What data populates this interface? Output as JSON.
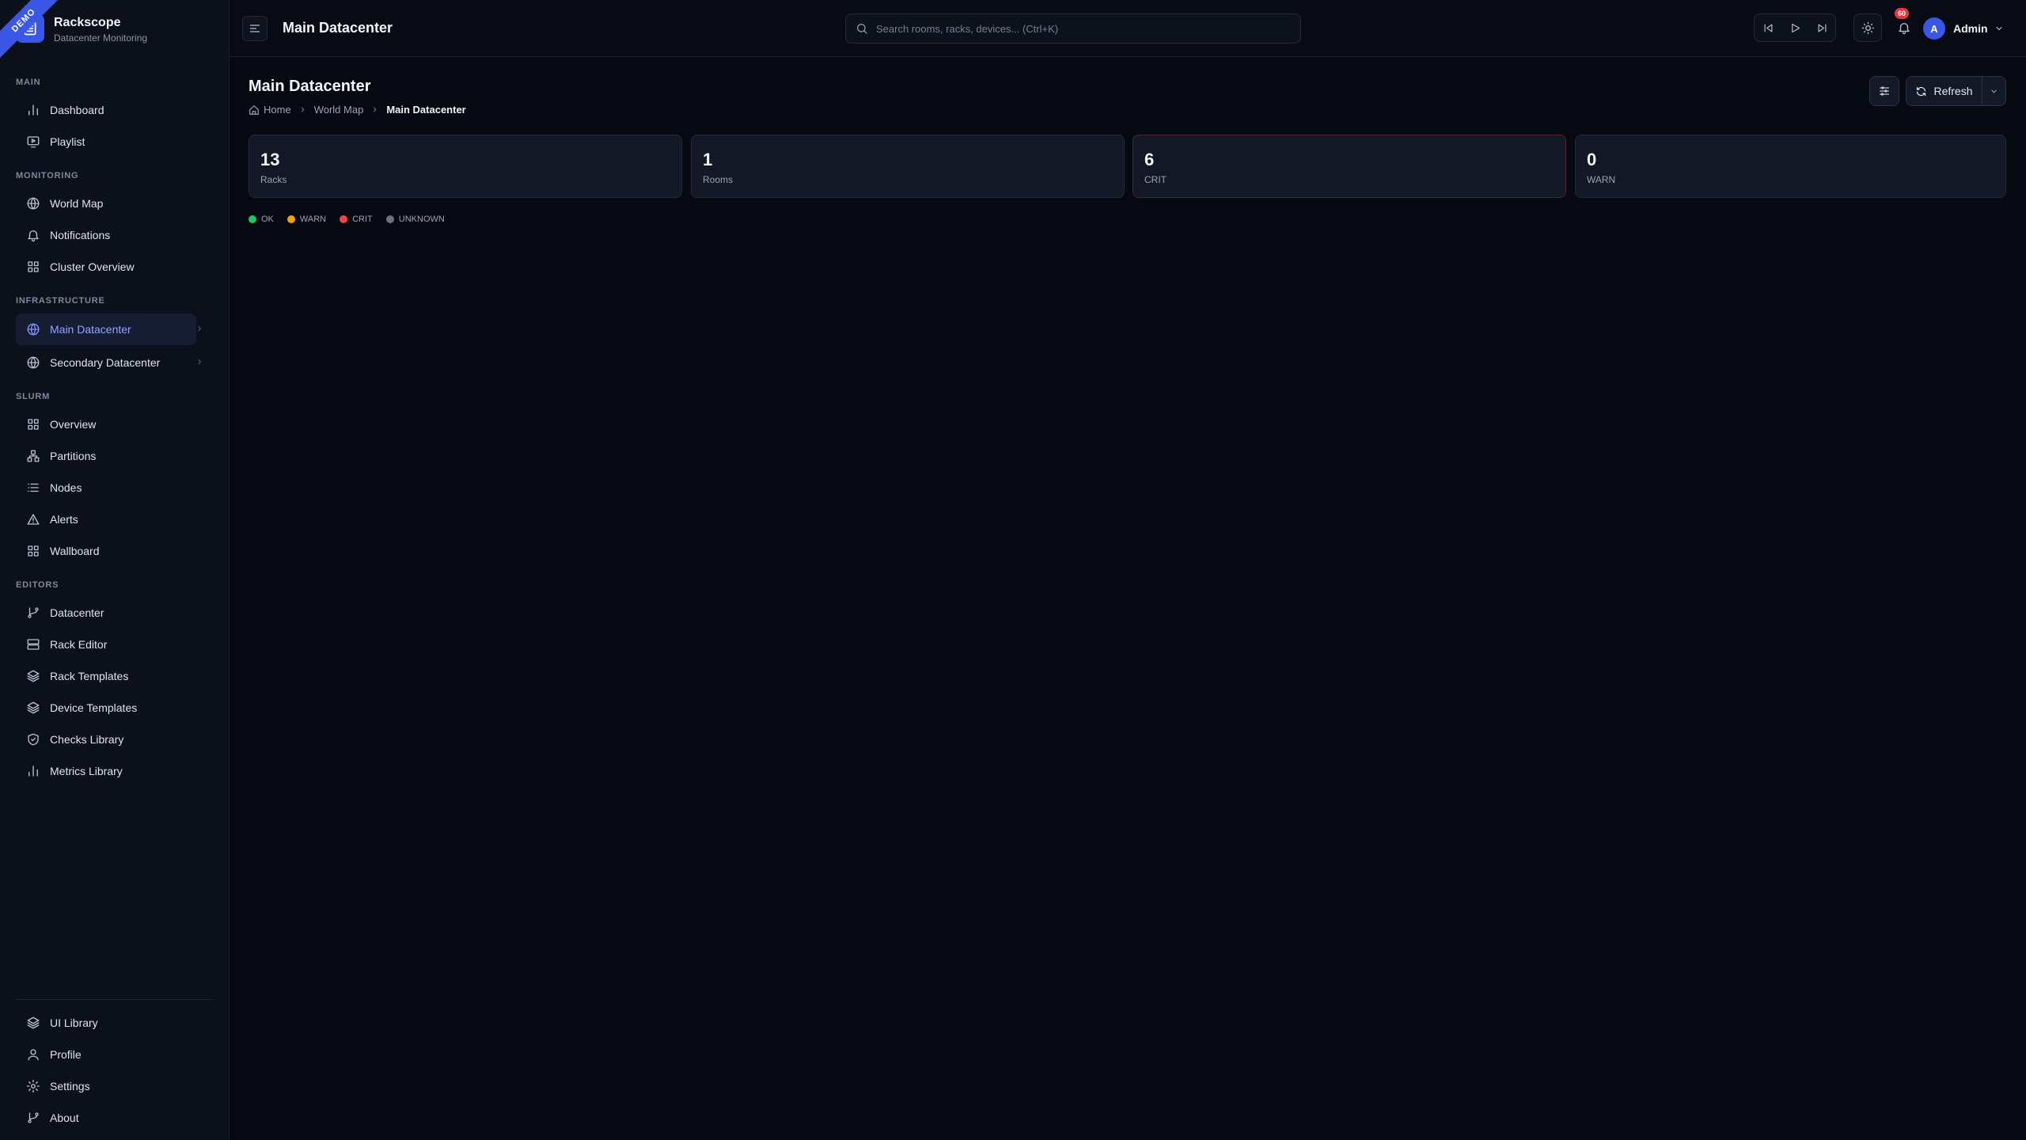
{
  "brand": {
    "ribbon": "DEMO",
    "name": "Rackscope",
    "subtitle": "Datacenter Monitoring"
  },
  "sidebar": {
    "sections": {
      "main": "MAIN",
      "monitoring": "MONITORING",
      "infrastructure": "INFRASTRUCTURE",
      "slurm": "SLURM",
      "editors": "EDITORS"
    },
    "items": {
      "dashboard": "Dashboard",
      "playlist": "Playlist",
      "world_map": "World Map",
      "notifications": "Notifications",
      "cluster_overview": "Cluster Overview",
      "main_datacenter": "Main Datacenter",
      "secondary_datacenter": "Secondary Datacenter",
      "overview": "Overview",
      "partitions": "Partitions",
      "nodes": "Nodes",
      "alerts": "Alerts",
      "wallboard": "Wallboard",
      "datacenter": "Datacenter",
      "rack_editor": "Rack Editor",
      "rack_templates": "Rack Templates",
      "device_templates": "Device Templates",
      "checks_library": "Checks Library",
      "metrics_library": "Metrics Library",
      "ui_library": "UI Library",
      "profile": "Profile",
      "settings": "Settings",
      "about": "About"
    }
  },
  "header": {
    "title": "Main Datacenter",
    "search_placeholder": "Search rooms, racks, devices... (Ctrl+K)",
    "notification_count": "60",
    "user_initial": "A",
    "user_name": "Admin"
  },
  "page": {
    "title": "Main Datacenter",
    "breadcrumb": [
      "Home",
      "World Map",
      "Main Datacenter"
    ],
    "refresh_label": "Refresh"
  },
  "stats": [
    {
      "value": "13",
      "label": "Racks"
    },
    {
      "value": "1",
      "label": "Rooms"
    },
    {
      "value": "6",
      "label": "CRIT"
    },
    {
      "value": "0",
      "label": "WARN"
    }
  ],
  "legend": [
    {
      "label": "OK",
      "color": "#22c55e"
    },
    {
      "label": "WARN",
      "color": "#f59e0b"
    },
    {
      "label": "CRIT",
      "color": "#ef4444"
    },
    {
      "label": "UNKNOWN",
      "color": "#6b7280"
    }
  ],
  "colors": {
    "accent": "#3b57e6",
    "active_text": "#8ea6ff",
    "badge": "#e5353d"
  }
}
